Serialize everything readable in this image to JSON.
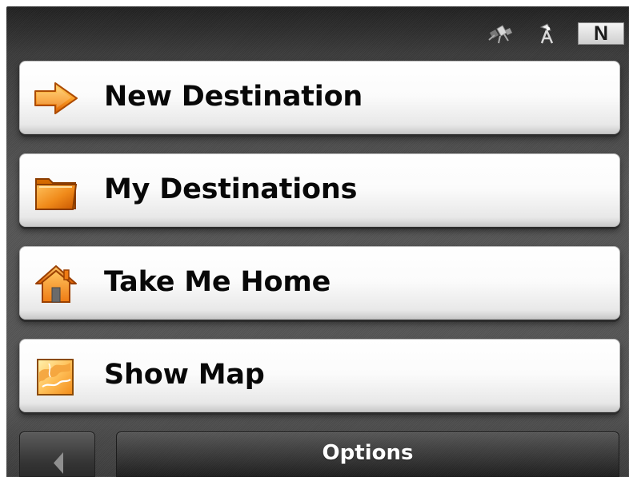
{
  "status": {
    "compass": "N",
    "icons": [
      "satellite-icon",
      "gps-antenna-icon"
    ]
  },
  "menu": {
    "items": [
      {
        "label": "New Destination",
        "icon": "arrow-right-icon"
      },
      {
        "label": "My Destinations",
        "icon": "folder-icon"
      },
      {
        "label": "Take Me Home",
        "icon": "home-icon"
      },
      {
        "label": "Show Map",
        "icon": "map-icon"
      }
    ]
  },
  "footer": {
    "options_label": "Options",
    "back_icon": "chevron-left-icon"
  },
  "colors": {
    "accent_orange": "#f28b18",
    "accent_orange_light": "#ffc15a",
    "button_text": "#080808",
    "background": "#555555"
  }
}
